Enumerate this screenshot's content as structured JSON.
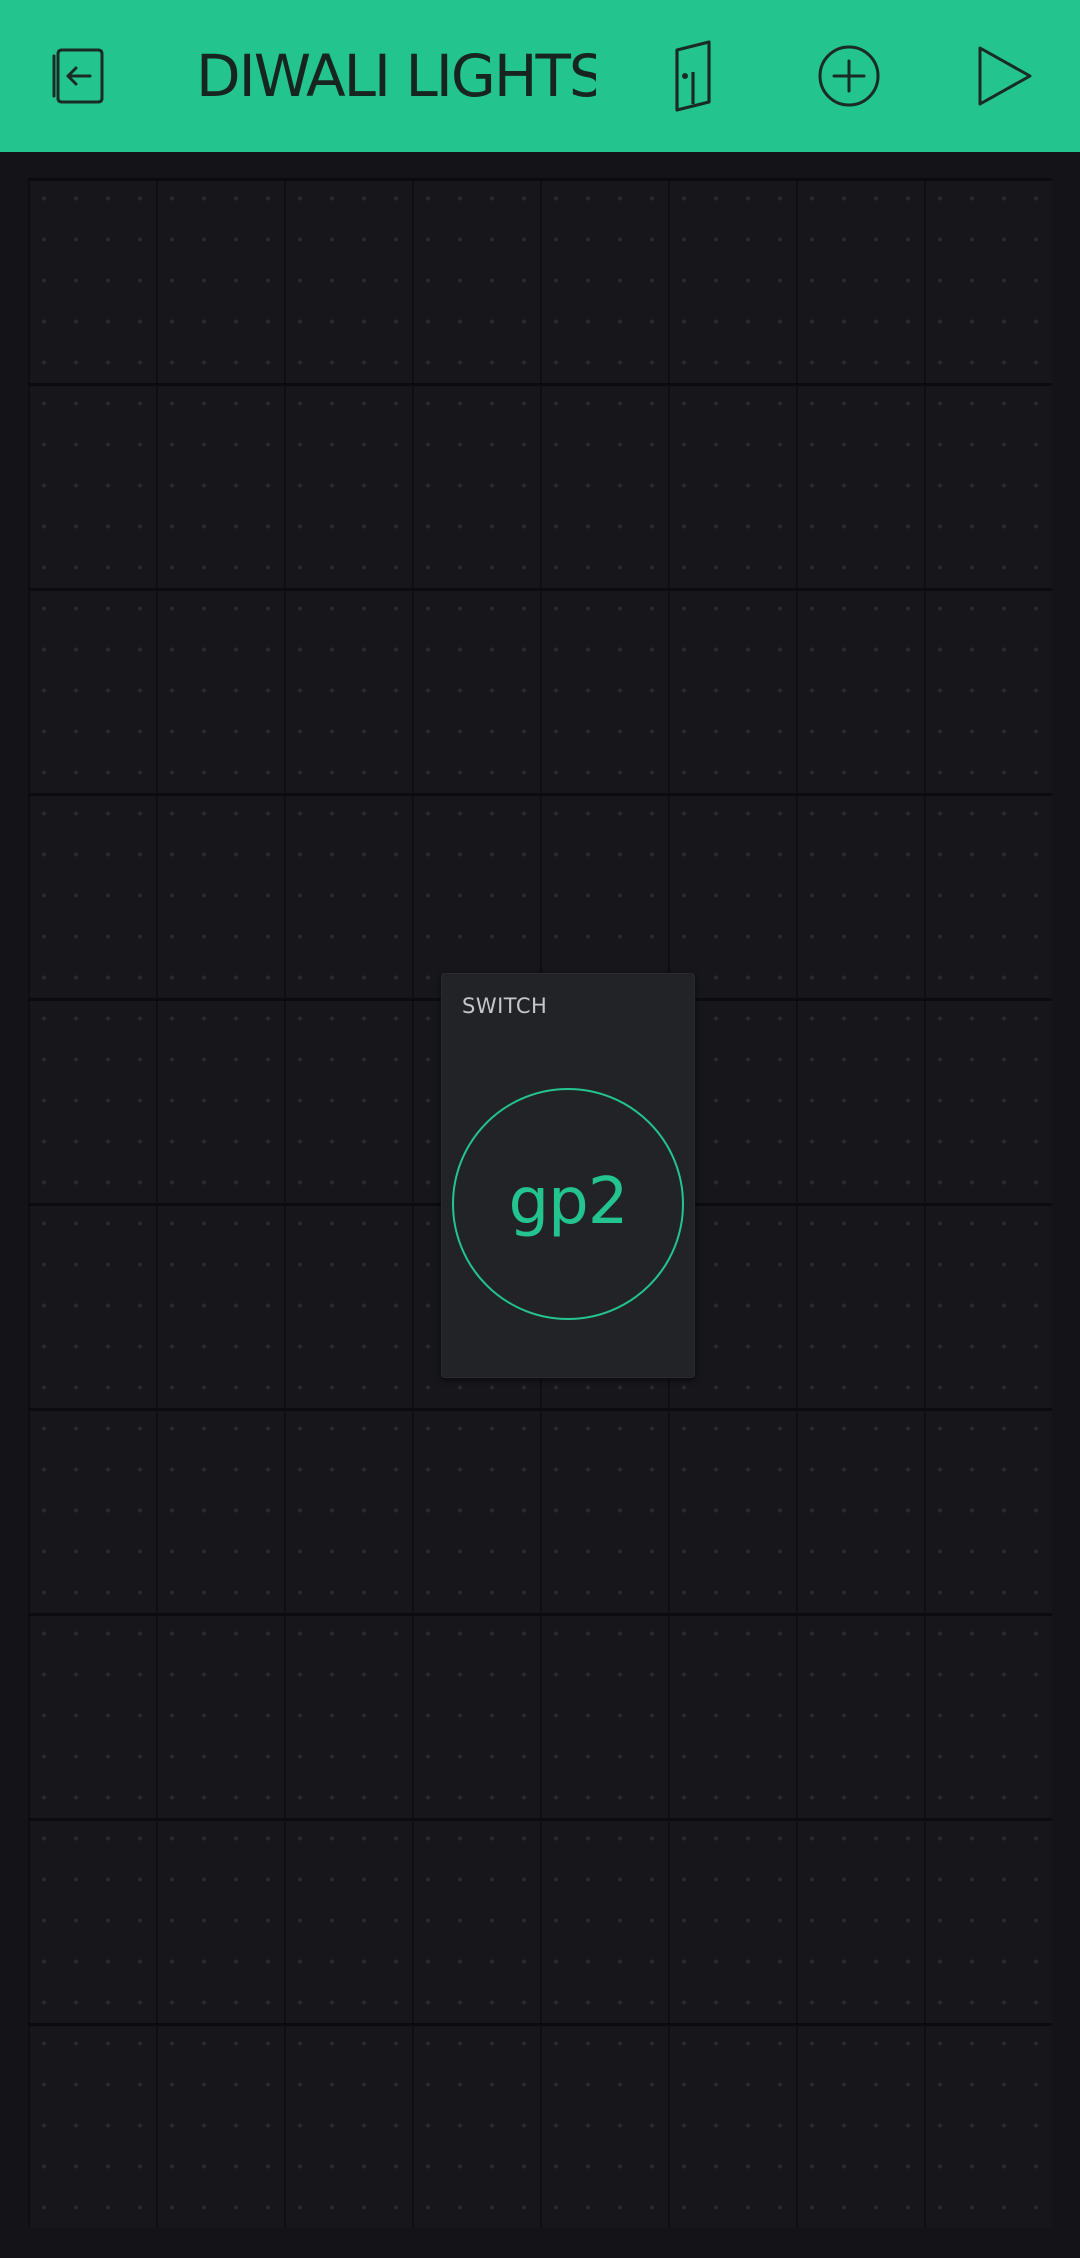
{
  "header": {
    "title": "DIWALI LIGHTS",
    "background_color": "#23c48e",
    "icon_color": "#1a2b25",
    "buttons": [
      {
        "name": "back-icon"
      },
      {
        "name": "project-settings-icon"
      },
      {
        "name": "add-widget-icon"
      },
      {
        "name": "play-icon"
      }
    ]
  },
  "canvas": {
    "background_color": "#16161b"
  },
  "widgets": [
    {
      "type": "switch",
      "label": "SWITCH",
      "pin": "gp2",
      "accent_color": "#23c48e"
    }
  ]
}
